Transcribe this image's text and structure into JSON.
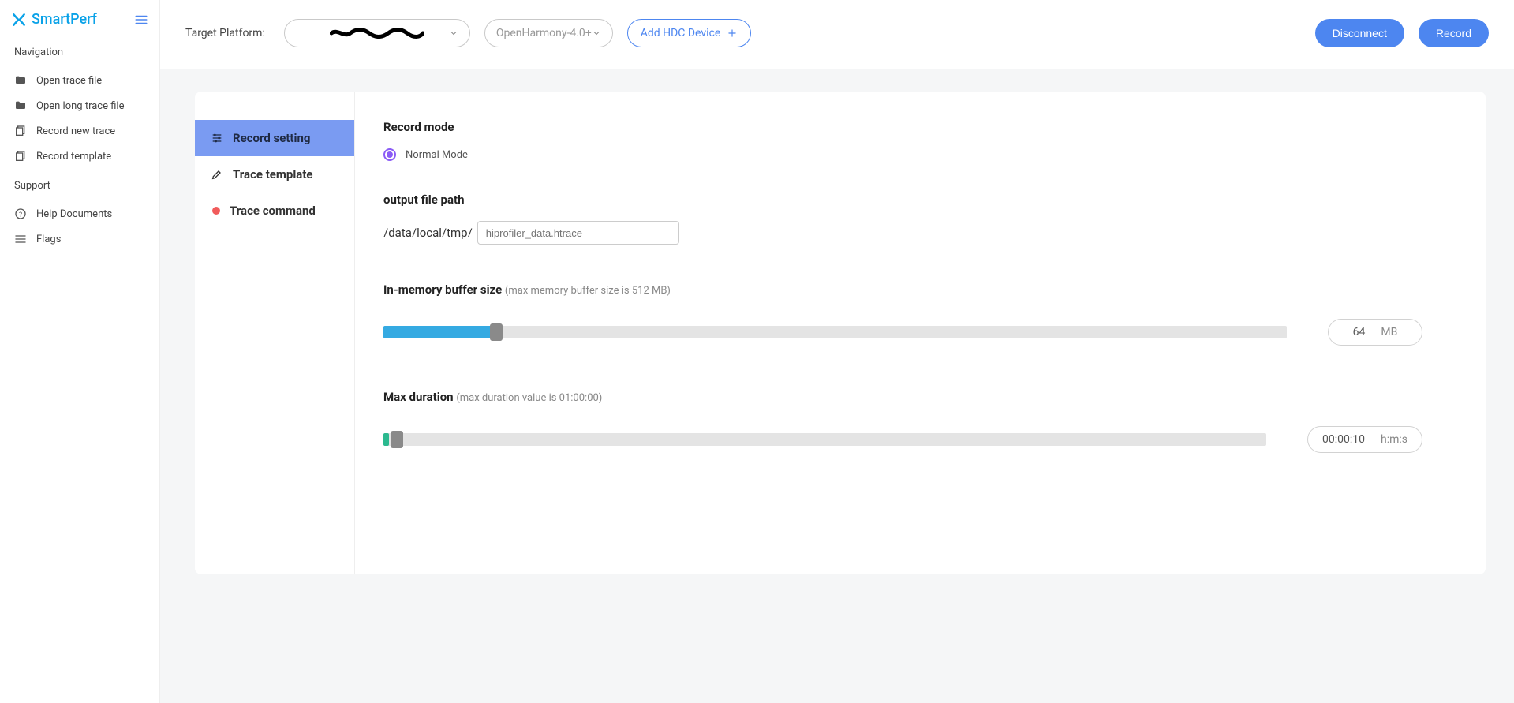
{
  "app": {
    "name": "SmartPerf"
  },
  "sidebar": {
    "sections": {
      "navigation": "Navigation",
      "support": "Support"
    },
    "items": [
      {
        "label": "Open trace file",
        "icon": "folder-icon"
      },
      {
        "label": "Open long trace file",
        "icon": "folder-icon"
      },
      {
        "label": "Record new trace",
        "icon": "copy-icon"
      },
      {
        "label": "Record template",
        "icon": "copy-icon"
      }
    ],
    "support_items": [
      {
        "label": "Help Documents",
        "icon": "help-icon"
      },
      {
        "label": "Flags",
        "icon": "lines-icon"
      }
    ]
  },
  "topbar": {
    "target_label": "Target Platform:",
    "device_value": "",
    "version_value": "OpenHarmony-4.0+",
    "add_hdc": "Add HDC Device",
    "disconnect": "Disconnect",
    "record": "Record"
  },
  "config_nav": [
    {
      "label": "Record setting",
      "icon": "sliders-icon",
      "active": true
    },
    {
      "label": "Trace template",
      "icon": "edit-icon",
      "active": false
    },
    {
      "label": "Trace command",
      "icon": "dot-icon",
      "active": false
    }
  ],
  "settings": {
    "record_mode": {
      "title": "Record mode",
      "option": "Normal Mode"
    },
    "output_path": {
      "title": "output file path",
      "prefix": "/data/local/tmp/",
      "placeholder": "hiprofiler_data.htrace"
    },
    "buffer": {
      "title": "In-memory buffer size",
      "hint": "(max memory buffer size is 512 MB)",
      "value": "64",
      "unit": "MB",
      "max": 512,
      "percent": 12.5
    },
    "duration": {
      "title": "Max duration",
      "hint": "(max duration value is 01:00:00)",
      "value": "00:00:10",
      "unit": "h:m:s",
      "percent": 0.28
    }
  }
}
